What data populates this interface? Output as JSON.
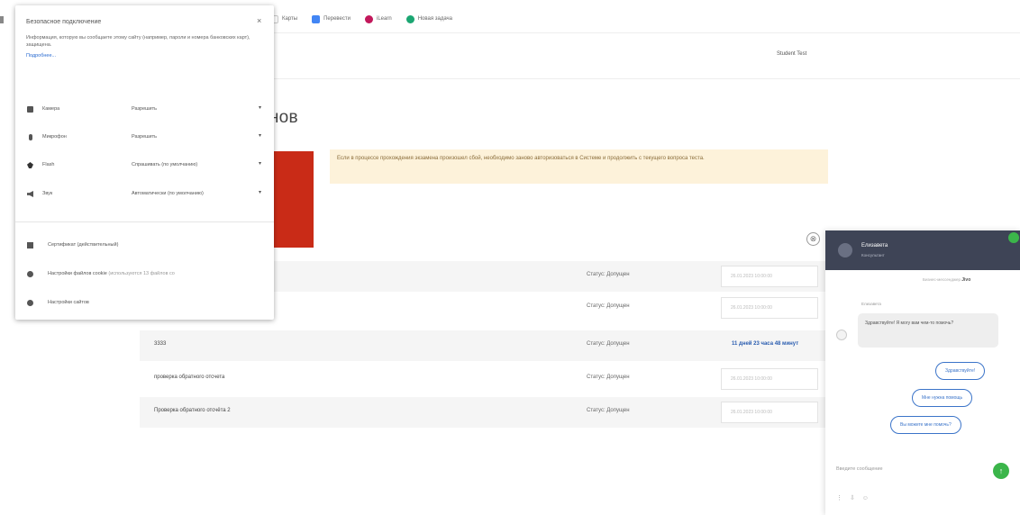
{
  "bookmarks": [
    {
      "label": "Карты",
      "color": "#ffffff"
    },
    {
      "label": "Перевести",
      "color": "#4285f4"
    },
    {
      "label": "iLearn",
      "color": "#c2185b"
    },
    {
      "label": "Новая задача",
      "color": "#1ba672"
    }
  ],
  "header": {
    "student": "Student Test"
  },
  "page": {
    "title": "енов",
    "warning": "Если в процессе прохождения экзамена произошел сбой, необходимо заново авторизоваться в Системе и продолжить с текущего вопроса теста."
  },
  "table": {
    "rows": [
      {
        "name": "",
        "status": "Статус: Допущен",
        "date": "26.01.2023 10:00:00",
        "countdown": ""
      },
      {
        "name": "",
        "status": "Статус: Допущен",
        "date": "26.01.2023 10:00:00",
        "countdown": ""
      },
      {
        "name": "3333",
        "status": "Статус: Допущен",
        "date": "",
        "countdown": "11 дней 23 часа 48 минут"
      },
      {
        "name": "проверка обратного отсчета",
        "status": "Статус: Допущен",
        "date": "26.01.2023 10:00:00",
        "countdown": ""
      },
      {
        "name": "Проверка обратного отсчёта 2",
        "status": "Статус: Допущен",
        "date": "26.01.2023 10:00:00",
        "countdown": ""
      }
    ]
  },
  "popup": {
    "title": "Безопасное подключение",
    "close": "×",
    "description": "Информация, которую вы сообщаете этому сайту (например, пароли и номера банковских карт), защищена.",
    "more": "Подробнее...",
    "permissions": [
      {
        "label": "Камера",
        "value": "Разрешить",
        "icon": "camera-icon"
      },
      {
        "label": "Микрофон",
        "value": "Разрешить",
        "icon": "microphone-icon"
      },
      {
        "label": "Flash",
        "value": "Спрашивать (по умолчанию)",
        "icon": "flash-icon"
      },
      {
        "label": "Звук",
        "value": "Автоматически (по умолчанию)",
        "icon": "sound-icon"
      }
    ],
    "certificate": "Сертификат (действительный)",
    "cookies": "Настройки файлов cookie",
    "cookies_sub": "(используются 13 файлов co",
    "site_settings": "Настройки сайтов"
  },
  "chat": {
    "operator_name": "Елизавета",
    "operator_role": "Консультант",
    "powered_by": "Бизнес-мессенджер",
    "powered_brand": "Jivo",
    "message_author": "Елизавета",
    "message": "Здравствуйте! Я могу вам чем-то помочь?",
    "quick_replies": [
      "Здравствуйте!",
      "Мне нужна помощь",
      "Вы можете мне помочь?"
    ],
    "input_placeholder": "Введите сообщение",
    "send_icon": "↑",
    "tools": "⋮ ⇩ ☺"
  },
  "colors": {
    "accent_red": "#c92b17",
    "warning_bg": "#fdf2da",
    "chat_header": "#3e4456",
    "online_green": "#3bb54a",
    "link_blue": "#3b74c9"
  }
}
